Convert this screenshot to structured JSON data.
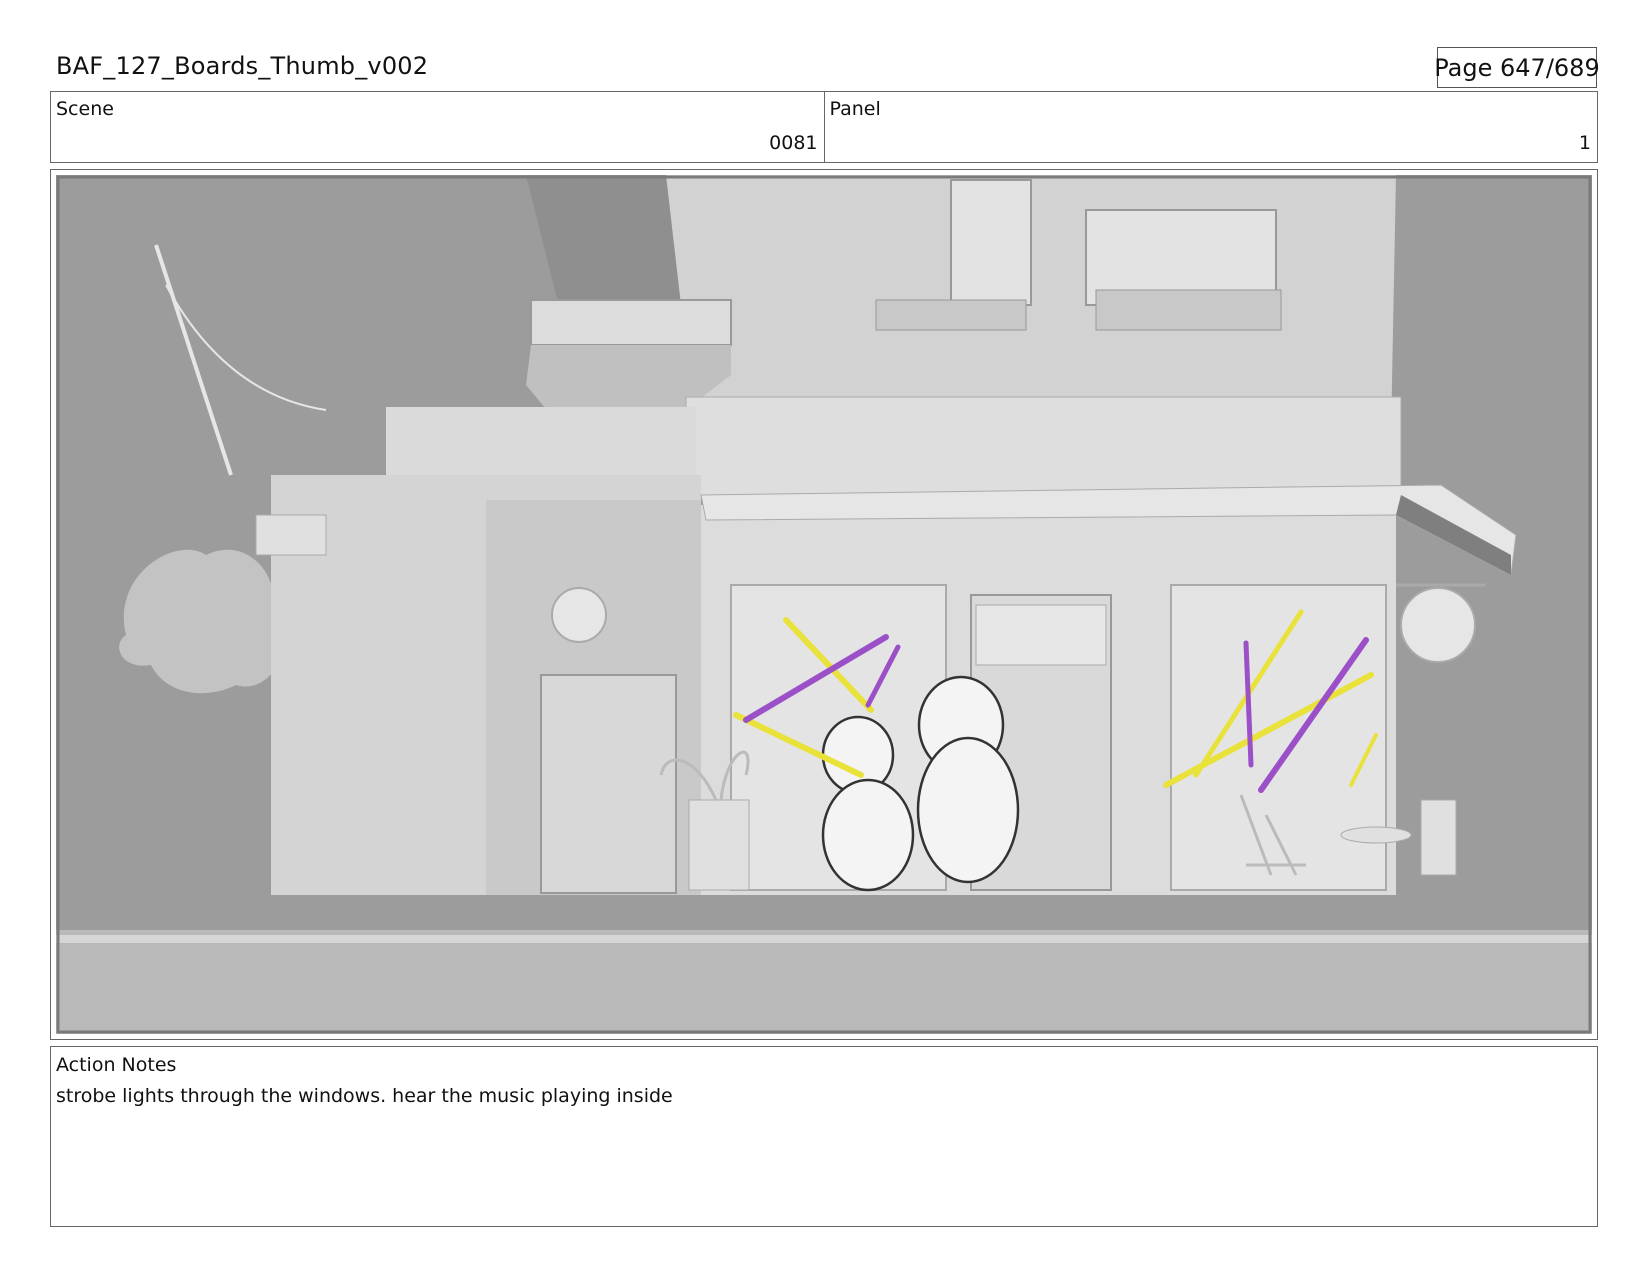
{
  "header": {
    "title": "BAF_127_Boards_Thumb_v002",
    "page": "Page 647/689"
  },
  "scene": {
    "label": "Scene",
    "value": "0081"
  },
  "panel": {
    "label": "Panel",
    "value": "1"
  },
  "action_notes": {
    "label": "Action Notes",
    "text": "strobe lights through the windows. hear the music playing inside"
  },
  "colors": {
    "strobe_yellow": "#e9e23a",
    "strobe_purple": "#9b50c8"
  }
}
